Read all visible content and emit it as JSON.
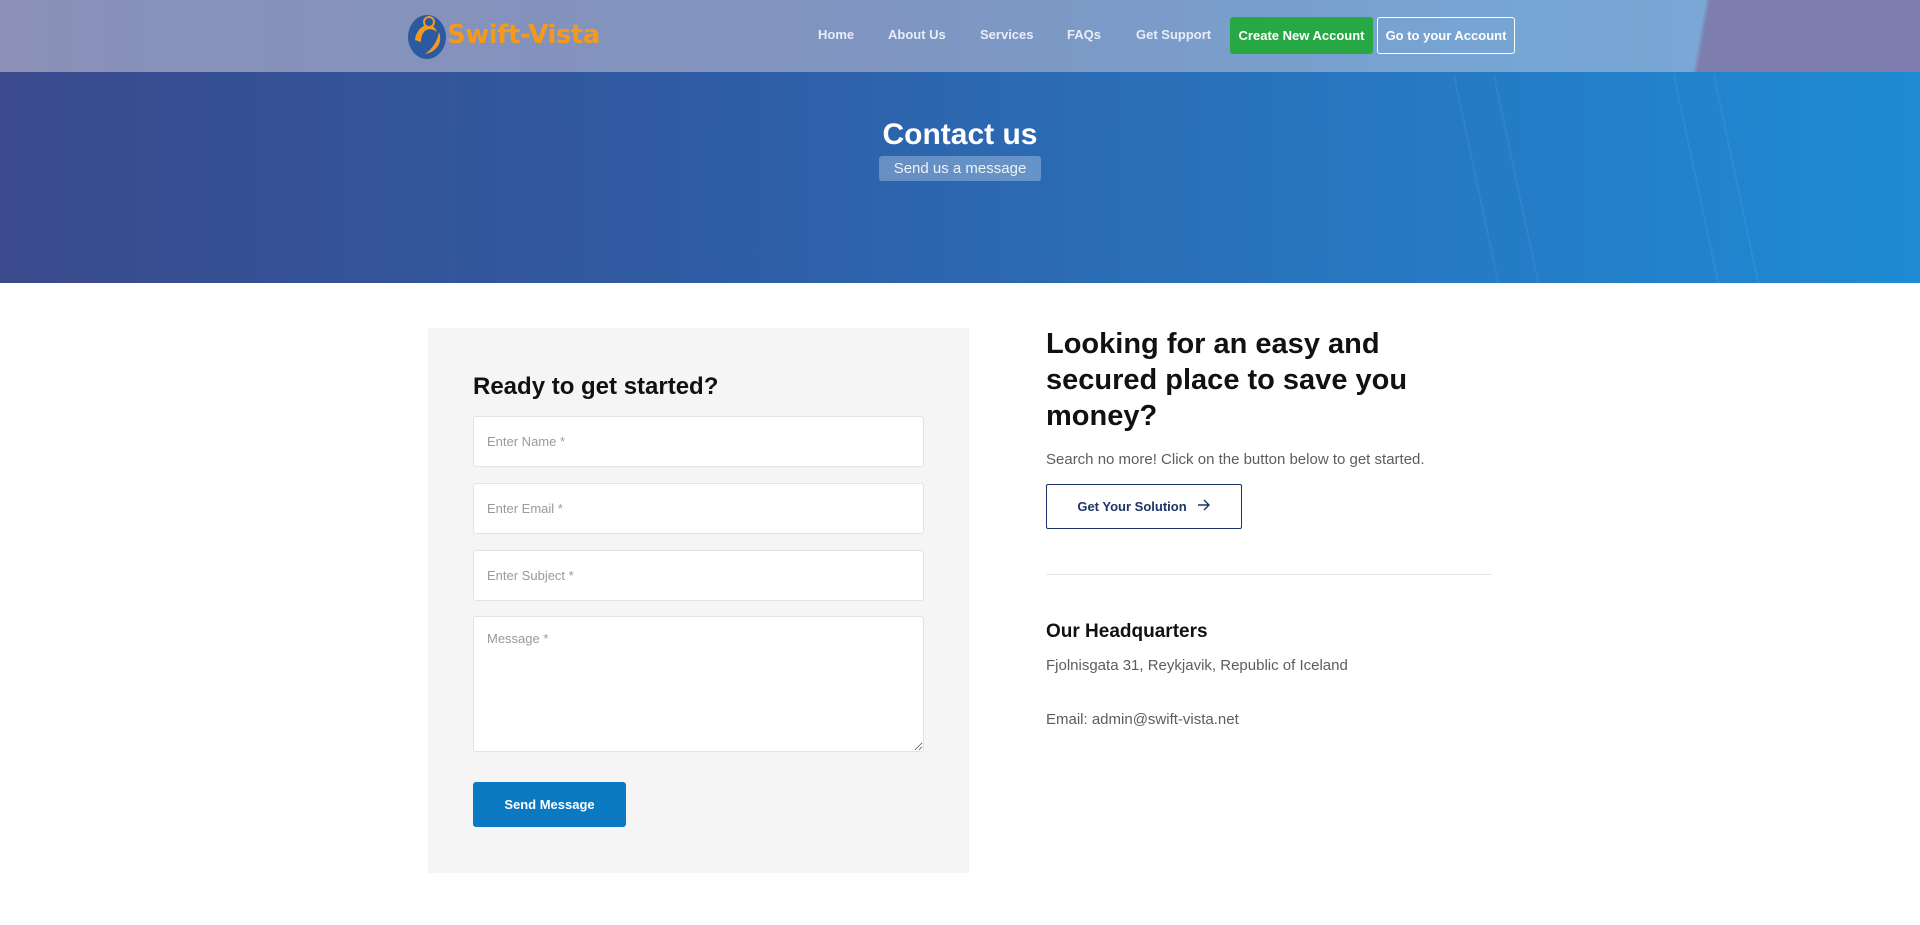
{
  "brand": {
    "name": "Swift-Vista"
  },
  "nav": {
    "items": [
      "Home",
      "About Us",
      "Services",
      "FAQs",
      "Get Support"
    ],
    "create_account": "Create New Account",
    "go_account": "Go to your Account"
  },
  "hero": {
    "title": "Contact us",
    "subtitle": "Send us a message"
  },
  "form": {
    "title": "Ready to get started?",
    "name_placeholder": "Enter Name *",
    "email_placeholder": "Enter Email *",
    "subject_placeholder": "Enter Subject *",
    "message_placeholder": "Message *",
    "send_label": "Send Message"
  },
  "info": {
    "title": "Looking for an easy and secured place to save you money?",
    "text": "Search no more! Click on the button below to get started.",
    "button": "Get Your Solution",
    "hq_title": "Our Headquarters",
    "hq_address": "Fjolnisgata 31, Reykjavik, Republic of Iceland",
    "hq_email": "Email: admin@swift-vista.net"
  },
  "colors": {
    "brand_orange": "#f39a1d",
    "create_green": "#27a844",
    "send_blue": "#0b78c2",
    "solution_navy": "#1d3466"
  }
}
